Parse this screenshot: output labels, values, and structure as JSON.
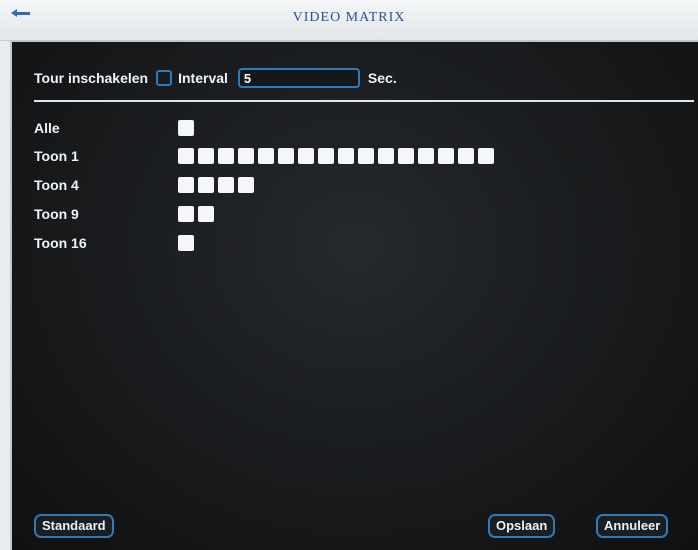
{
  "window": {
    "title": "VIDEO MATRIX",
    "icon": "back-arrow-icon"
  },
  "tour": {
    "enable_label": "Tour inschakelen",
    "enabled": false,
    "interval_label": "Interval",
    "interval_value": "5",
    "unit_label": "Sec."
  },
  "rows": [
    {
      "label": "Alle",
      "cells": 1
    },
    {
      "label": "Toon 1",
      "cells": 16
    },
    {
      "label": "Toon 4",
      "cells": 4
    },
    {
      "label": "Toon 9",
      "cells": 2
    },
    {
      "label": "Toon 16",
      "cells": 1
    }
  ],
  "buttons": {
    "default": "Standaard",
    "save": "Opslaan",
    "cancel": "Annuleer"
  },
  "colors": {
    "accent": "#2f7bb8",
    "title": "#2d4f9a",
    "panel": "#1b1e21",
    "cell": "#f4f6f7"
  }
}
